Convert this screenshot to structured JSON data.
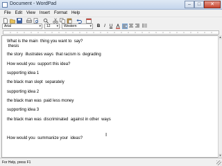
{
  "window": {
    "title": "Document - WordPad"
  },
  "menu": [
    "File",
    "Edit",
    "View",
    "Insert",
    "Format",
    "Help"
  ],
  "toolbar": [
    "new-icon",
    "open-icon",
    "save-icon",
    "print-icon",
    "print-preview-icon",
    "find-icon",
    "cut-icon",
    "copy-icon",
    "paste-icon",
    "undo-icon",
    "date-time-icon"
  ],
  "format": {
    "font": "Arial",
    "size": "12",
    "script": "Western",
    "bold": "B",
    "italic": "I",
    "underline": "U"
  },
  "document": {
    "lines": [
      "What is the main  thing you want to  say?",
      " thesis",
      "the story  illustrates ways  that racism is  degrading",
      "How would you  support this idea?",
      "supporting idea 1",
      "the black man slept  separately",
      "supporting idea 2",
      "the black man was  paid less money",
      "supporting idea 3",
      "the black man was  discriminated  against in other  ways",
      "How would you  summanize your  ideas?"
    ]
  },
  "status": {
    "text": "For Help, press F1"
  }
}
